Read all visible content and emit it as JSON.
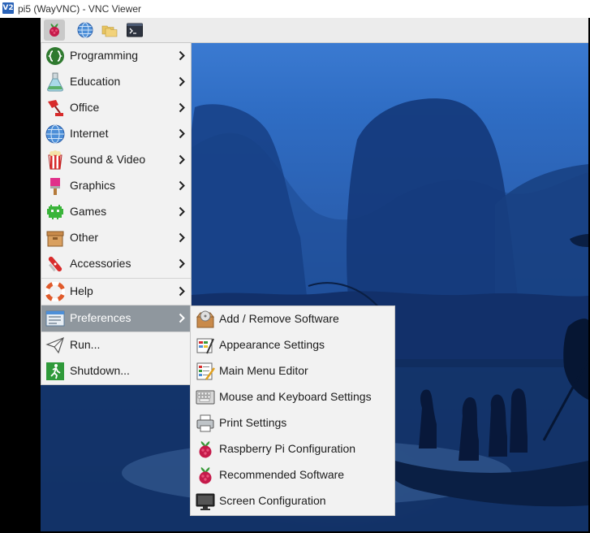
{
  "window": {
    "title": "pi5 (WayVNC) - VNC Viewer",
    "logo_text": "V2"
  },
  "taskbar": {
    "buttons": [
      {
        "icon": "raspberry-icon",
        "active": true
      },
      {
        "icon": "globe-icon"
      },
      {
        "icon": "folders-icon"
      },
      {
        "icon": "terminal-icon"
      }
    ]
  },
  "main_menu": {
    "items": [
      {
        "label": "Programming",
        "icon": "programming-icon",
        "submenu": true
      },
      {
        "label": "Education",
        "icon": "education-icon",
        "submenu": true
      },
      {
        "label": "Office",
        "icon": "office-icon",
        "submenu": true
      },
      {
        "label": "Internet",
        "icon": "internet-icon",
        "submenu": true
      },
      {
        "label": "Sound & Video",
        "icon": "sound-video-icon",
        "submenu": true
      },
      {
        "label": "Graphics",
        "icon": "graphics-icon",
        "submenu": true
      },
      {
        "label": "Games",
        "icon": "games-icon",
        "submenu": true
      },
      {
        "label": "Other",
        "icon": "other-icon",
        "submenu": true
      },
      {
        "label": "Accessories",
        "icon": "accessories-icon",
        "submenu": true
      },
      {
        "label": "Help",
        "icon": "help-icon",
        "submenu": true
      },
      {
        "label": "Preferences",
        "icon": "preferences-icon",
        "submenu": true,
        "highlighted": true
      },
      {
        "label": "Run...",
        "icon": "run-icon"
      },
      {
        "label": "Shutdown...",
        "icon": "shutdown-icon"
      }
    ]
  },
  "preferences_menu": {
    "items": [
      {
        "label": "Add / Remove Software",
        "icon": "package-icon"
      },
      {
        "label": "Appearance Settings",
        "icon": "appearance-icon"
      },
      {
        "label": "Main Menu Editor",
        "icon": "menu-editor-icon"
      },
      {
        "label": "Mouse and Keyboard Settings",
        "icon": "keyboard-icon"
      },
      {
        "label": "Print Settings",
        "icon": "printer-icon"
      },
      {
        "label": "Raspberry Pi Configuration",
        "icon": "raspberry-icon"
      },
      {
        "label": "Recommended Software",
        "icon": "raspberry-icon"
      },
      {
        "label": "Screen Configuration",
        "icon": "monitor-icon"
      }
    ]
  },
  "colors": {
    "highlight": "#8f979e",
    "menu_bg": "#f2f2f2",
    "wallpaper_top": "#3f7fd6",
    "wallpaper_bottom": "#0f2d61"
  }
}
